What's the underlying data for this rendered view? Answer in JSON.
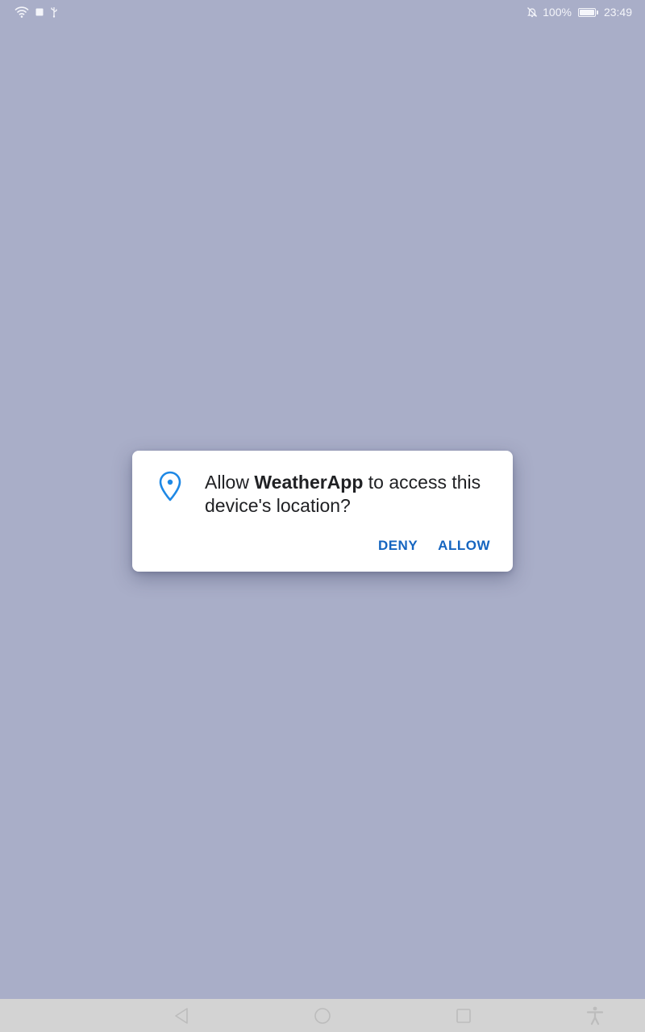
{
  "status_bar": {
    "battery_text": "100%",
    "battery_level": 1.0,
    "time": "23:49",
    "left_icons": [
      "wifi-icon",
      "square-notification-icon",
      "usb-icon"
    ],
    "right_icons": [
      "notifications-off-icon",
      "battery-icon"
    ]
  },
  "dialog": {
    "message_prefix": "Allow ",
    "app_name": "WeatherApp",
    "message_suffix": " to access this device's location?",
    "icon": "location-pin-icon",
    "deny_label": "DENY",
    "allow_label": "ALLOW",
    "accent_color": "#1e88e5"
  },
  "nav_bar": {
    "buttons": [
      "back-icon",
      "home-icon",
      "recents-icon",
      "accessibility-icon"
    ]
  },
  "colors": {
    "background": "#a9aec8",
    "dialog_background": "#ffffff",
    "button_text": "#1565c0",
    "nav_background": "#d3d3d3"
  }
}
